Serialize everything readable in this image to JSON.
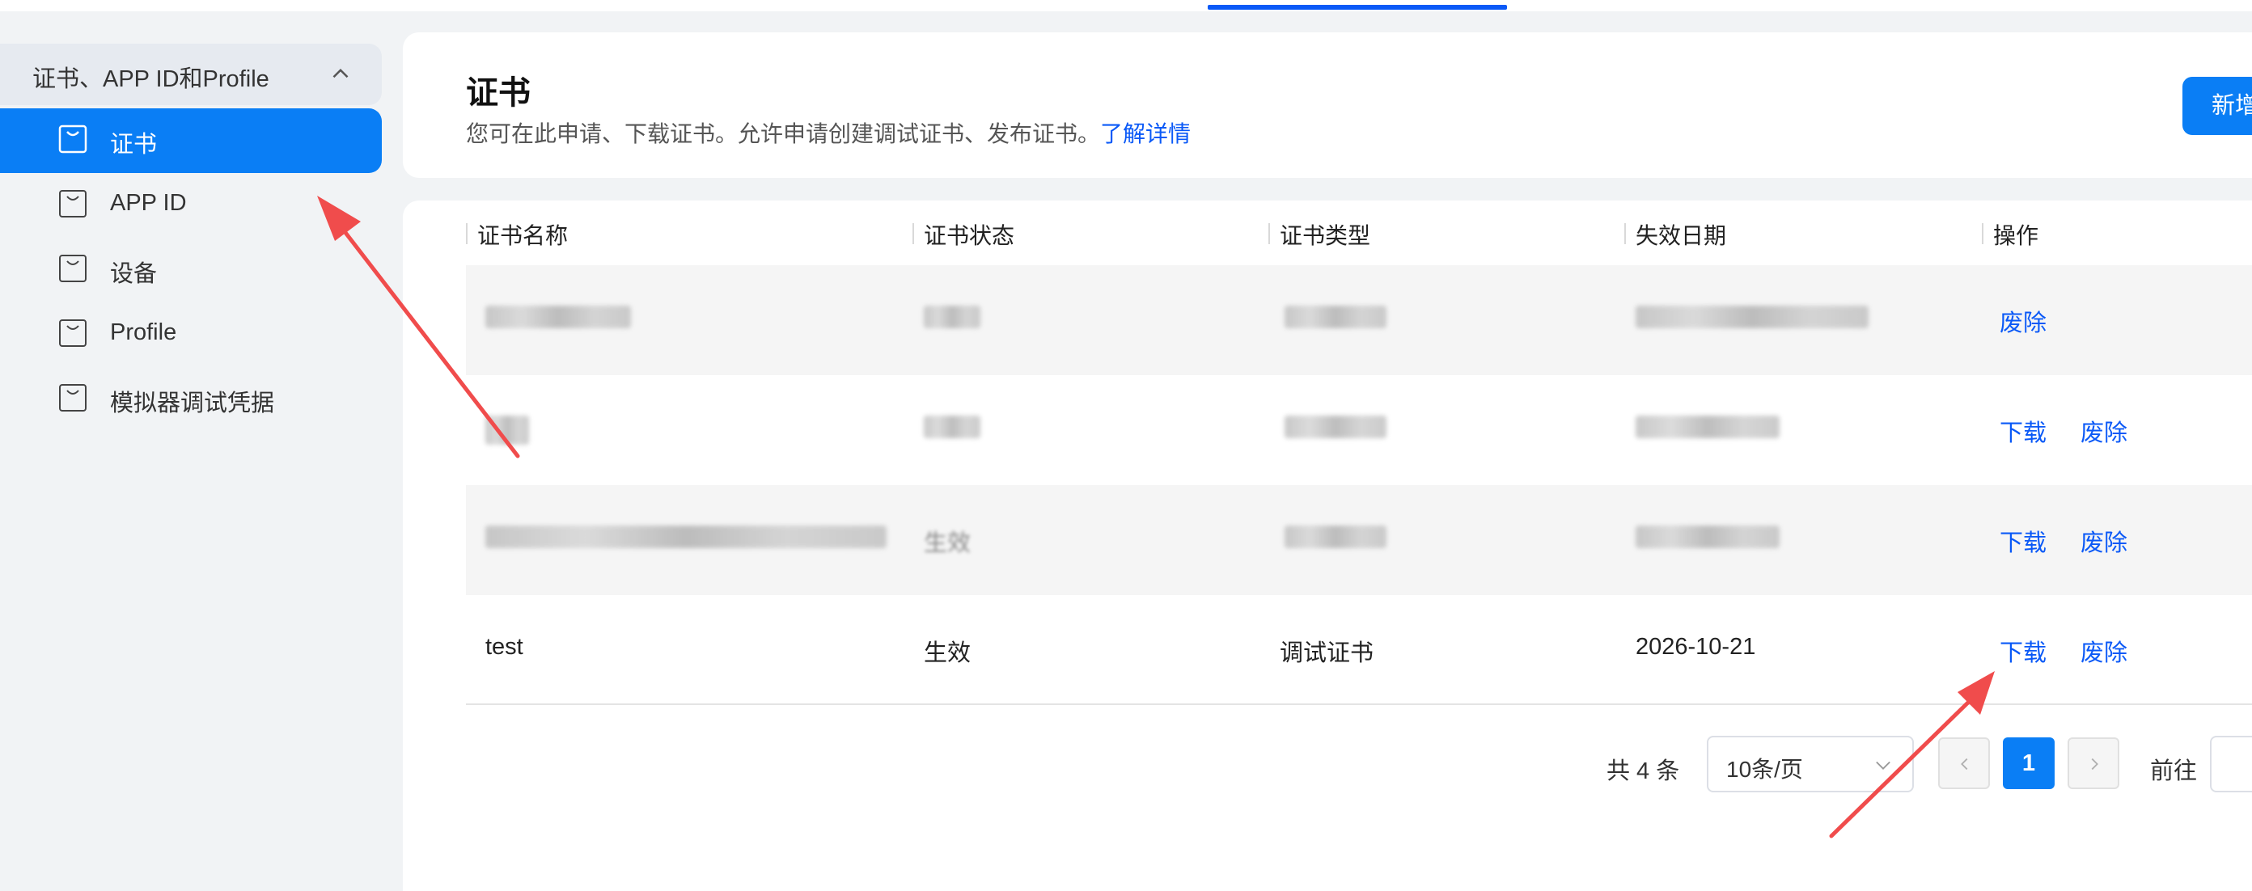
{
  "sidebar": {
    "group_label": "证书、APP ID和Profile",
    "items": [
      {
        "label": "证书",
        "active": true
      },
      {
        "label": "APP ID",
        "active": false
      },
      {
        "label": "设备",
        "active": false
      },
      {
        "label": "Profile",
        "active": false
      },
      {
        "label": "模拟器调试凭据",
        "active": false
      }
    ]
  },
  "header": {
    "title": "证书",
    "description": "您可在此申请、下载证书。允许申请创建调试证书、发布证书。",
    "learn_more": "了解详情",
    "new_button": "新增"
  },
  "table": {
    "columns": [
      "证书名称",
      "证书状态",
      "证书类型",
      "失效日期",
      "操作"
    ],
    "rows": [
      {
        "name": "",
        "status": "",
        "type": "",
        "expiry": "",
        "actions": [
          "废除"
        ],
        "redacted": true
      },
      {
        "name": "",
        "status": "",
        "type": "",
        "expiry": "",
        "actions": [
          "下载",
          "废除"
        ],
        "redacted": true
      },
      {
        "name": "",
        "status": "生效",
        "type": "",
        "expiry": "",
        "actions": [
          "下载",
          "废除"
        ],
        "redacted": true
      },
      {
        "name": "test",
        "status": "生效",
        "type": "调试证书",
        "expiry": "2026-10-21",
        "actions": [
          "下载",
          "废除"
        ],
        "redacted": false
      }
    ]
  },
  "pagination": {
    "total_text": "共 4 条",
    "page_size": "10条/页",
    "current_page": "1",
    "goto_label": "前往"
  },
  "colors": {
    "accent": "#0a7ef5",
    "link": "#0a59f7",
    "annotation_arrow": "#f04c4c"
  }
}
